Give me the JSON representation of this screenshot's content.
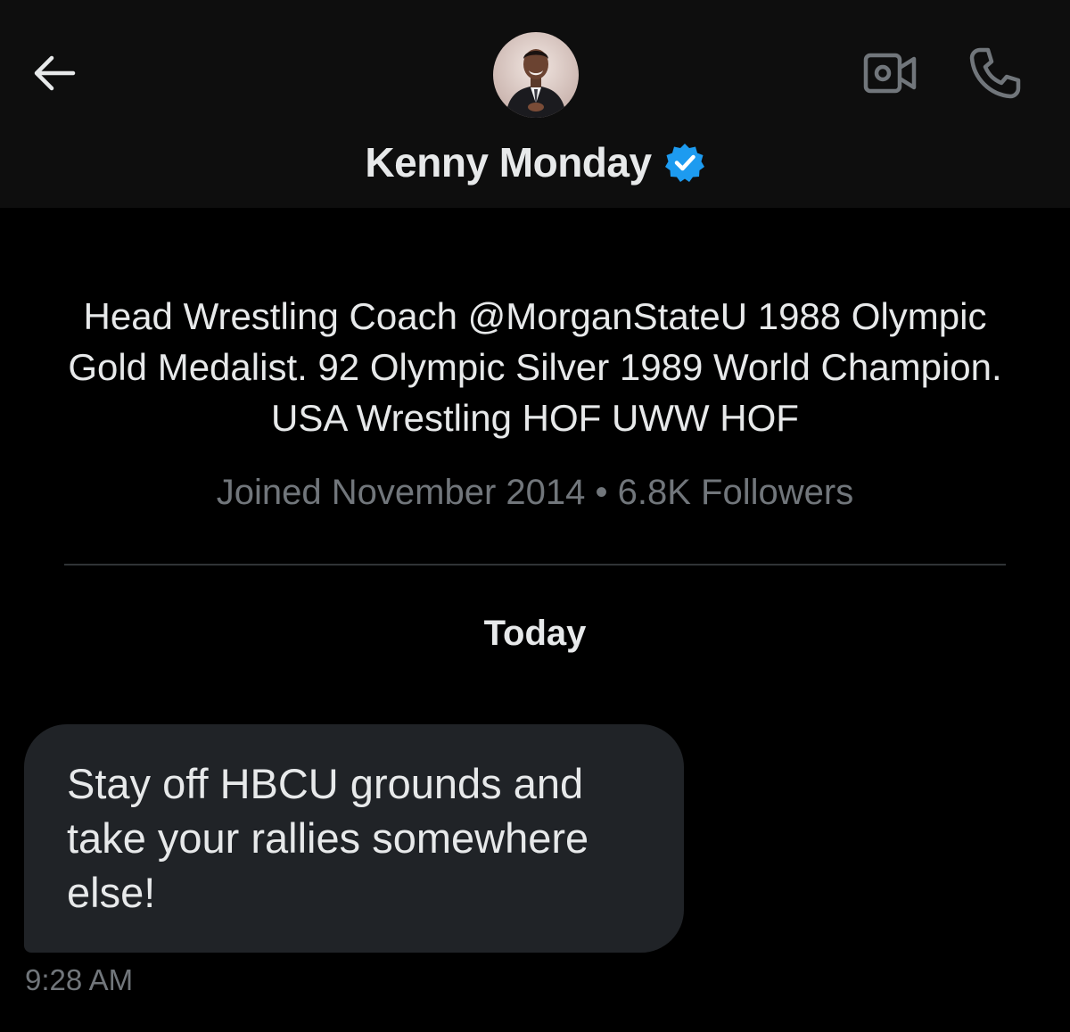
{
  "header": {
    "back_icon": "arrow-left-icon",
    "video_icon": "video-camera-icon",
    "call_icon": "phone-icon",
    "name": "Kenny Monday",
    "verified_icon": "verified-badge-icon",
    "verified_color": "#1d9bf0"
  },
  "profile": {
    "bio": "Head Wrestling Coach @MorganStateU 1988 Olympic Gold Medalist. 92 Olympic Silver 1989 World Champion. USA Wrestling HOF UWW HOF",
    "joined": "Joined November 2014",
    "separator": "•",
    "followers": "6.8K Followers"
  },
  "conversation": {
    "date_label": "Today",
    "messages": [
      {
        "text": "Stay off HBCU grounds and take your rallies somewhere else!",
        "time": "9:28 AM"
      }
    ]
  },
  "colors": {
    "background": "#000000",
    "header_background": "#0e0e0e",
    "bubble_background": "#202327",
    "primary_text": "#e7e9ea",
    "secondary_text": "#71767b",
    "divider": "#2f3336"
  }
}
